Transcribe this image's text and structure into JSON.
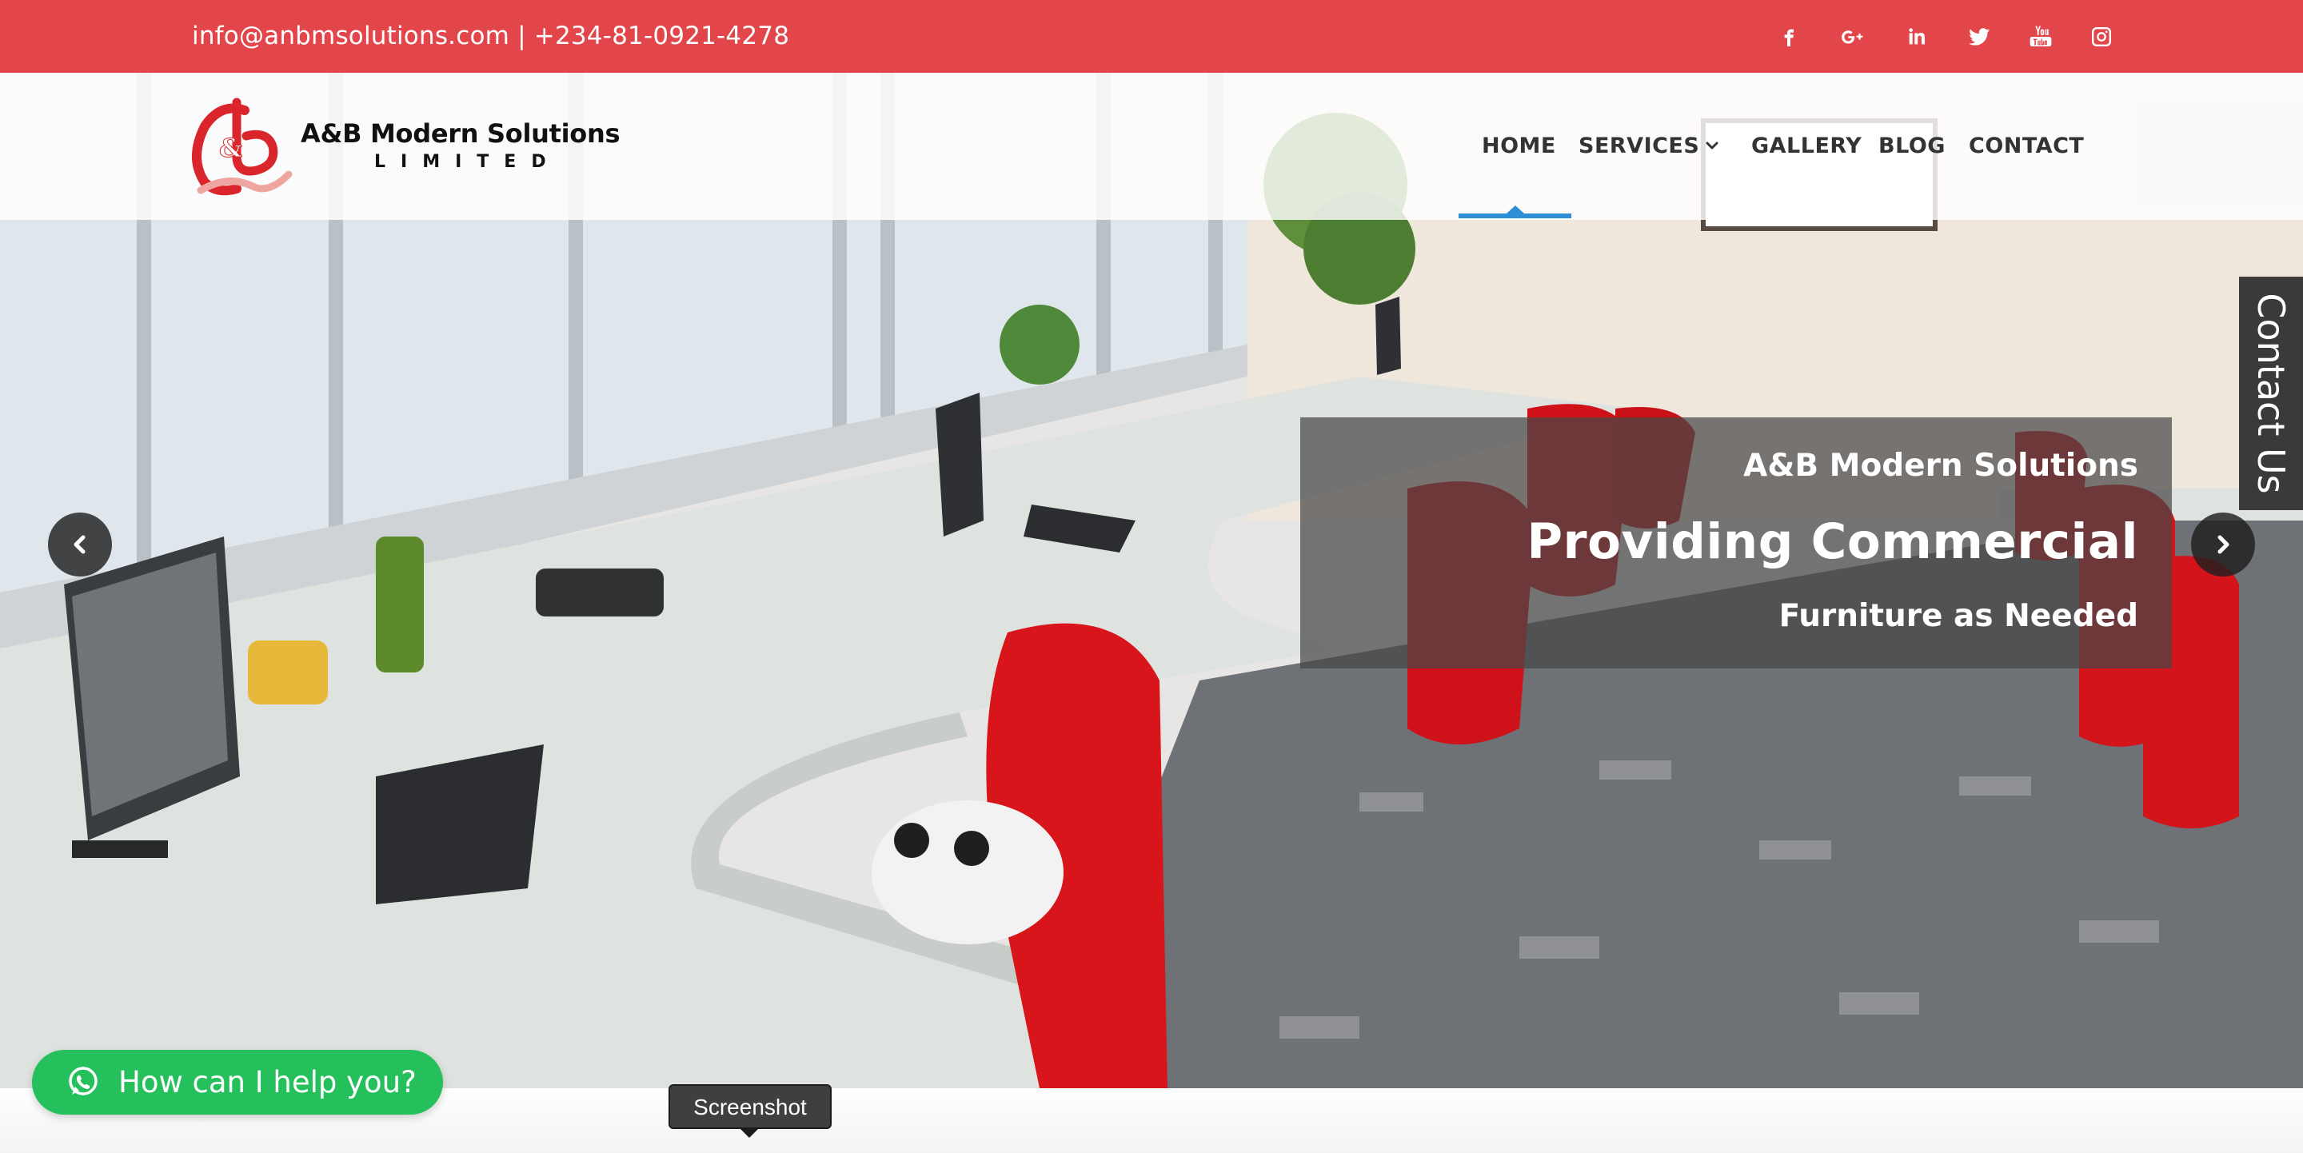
{
  "topbar": {
    "contact_text": "info@anbmsolutions.com | +234-81-0921-4278",
    "background": "#e2454a",
    "social_icons": [
      "facebook-icon",
      "google-plus-icon",
      "linkedin-icon",
      "twitter-icon",
      "youtube-icon",
      "instagram-icon"
    ]
  },
  "logo": {
    "name": "A&B Modern Solutions",
    "subtitle": "LIMITED"
  },
  "nav": {
    "items": [
      {
        "label": "HOME",
        "active": true
      },
      {
        "label": "SERVICES",
        "has_dropdown": true
      },
      {
        "label": "GALLERY"
      },
      {
        "label": "BLOG"
      },
      {
        "label": "CONTACT"
      }
    ],
    "active_color": "#2d8fd5"
  },
  "hero": {
    "caption": {
      "line1": "A&B Modern Solutions",
      "line2": "Providing Commercial",
      "line3": "Furniture as Needed"
    },
    "prev_icon": "chevron-left-icon",
    "next_icon": "chevron-right-icon"
  },
  "contact_tab": {
    "label": "Contact Us"
  },
  "whatsapp": {
    "label": "How can I help you?",
    "color": "#25c05b"
  },
  "tooltip": {
    "label": "Screenshot"
  }
}
